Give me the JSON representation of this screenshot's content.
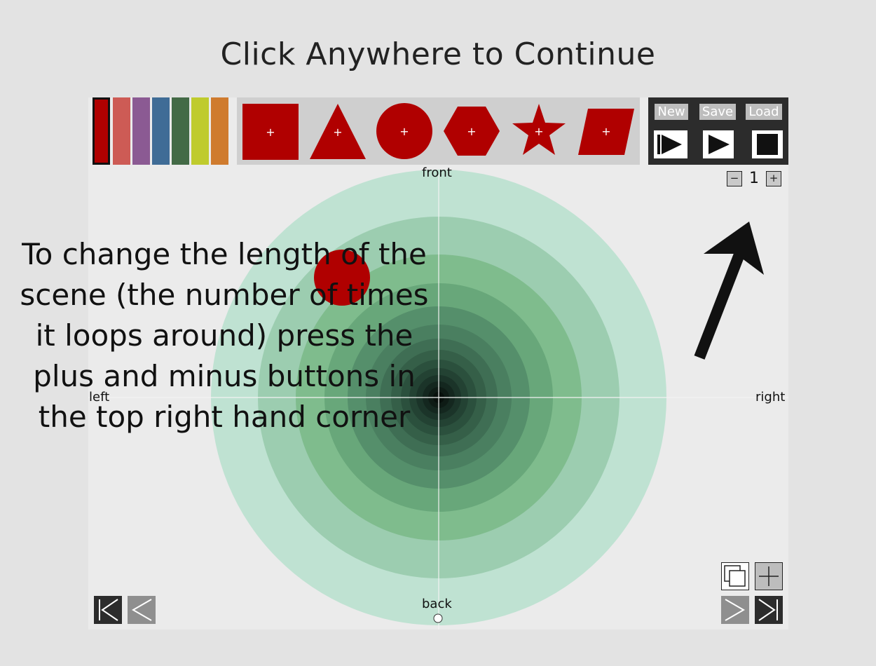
{
  "overlay": {
    "title": "Click Anywhere to Continue",
    "instruction": "To change the length of the\nscene (the number of times\nit loops around) press the\nplus and minus buttons in\nthe top right hand corner"
  },
  "palette": {
    "colors": [
      "#b00000",
      "#cd5b55",
      "#8b5a93",
      "#3f6c96",
      "#436a46",
      "#bfcb2d",
      "#cf7b2e"
    ],
    "selected_index": 0
  },
  "shapes": {
    "fill": "#b00000",
    "items": [
      "square",
      "triangle",
      "circle",
      "hexagon",
      "star",
      "parallelogram"
    ],
    "add_glyph": "+"
  },
  "controls": {
    "new_label": "New",
    "save_label": "Save",
    "load_label": "Load"
  },
  "length": {
    "minus_label": "−",
    "value": "1",
    "plus_label": "+"
  },
  "stage": {
    "front_label": "front",
    "back_label": "back",
    "left_label": "left",
    "right_label": "right",
    "ring_colors": [
      "#bfe2d2",
      "#9ccdb0",
      "#7fbc8d",
      "#68a77a",
      "#558f6b",
      "#4a7f60",
      "#3f6e54",
      "#355f48",
      "#2b503d",
      "#234233",
      "#1b3429",
      "#14271f",
      "#0e1b15",
      "#08100c"
    ],
    "object_color": "#b00000"
  }
}
